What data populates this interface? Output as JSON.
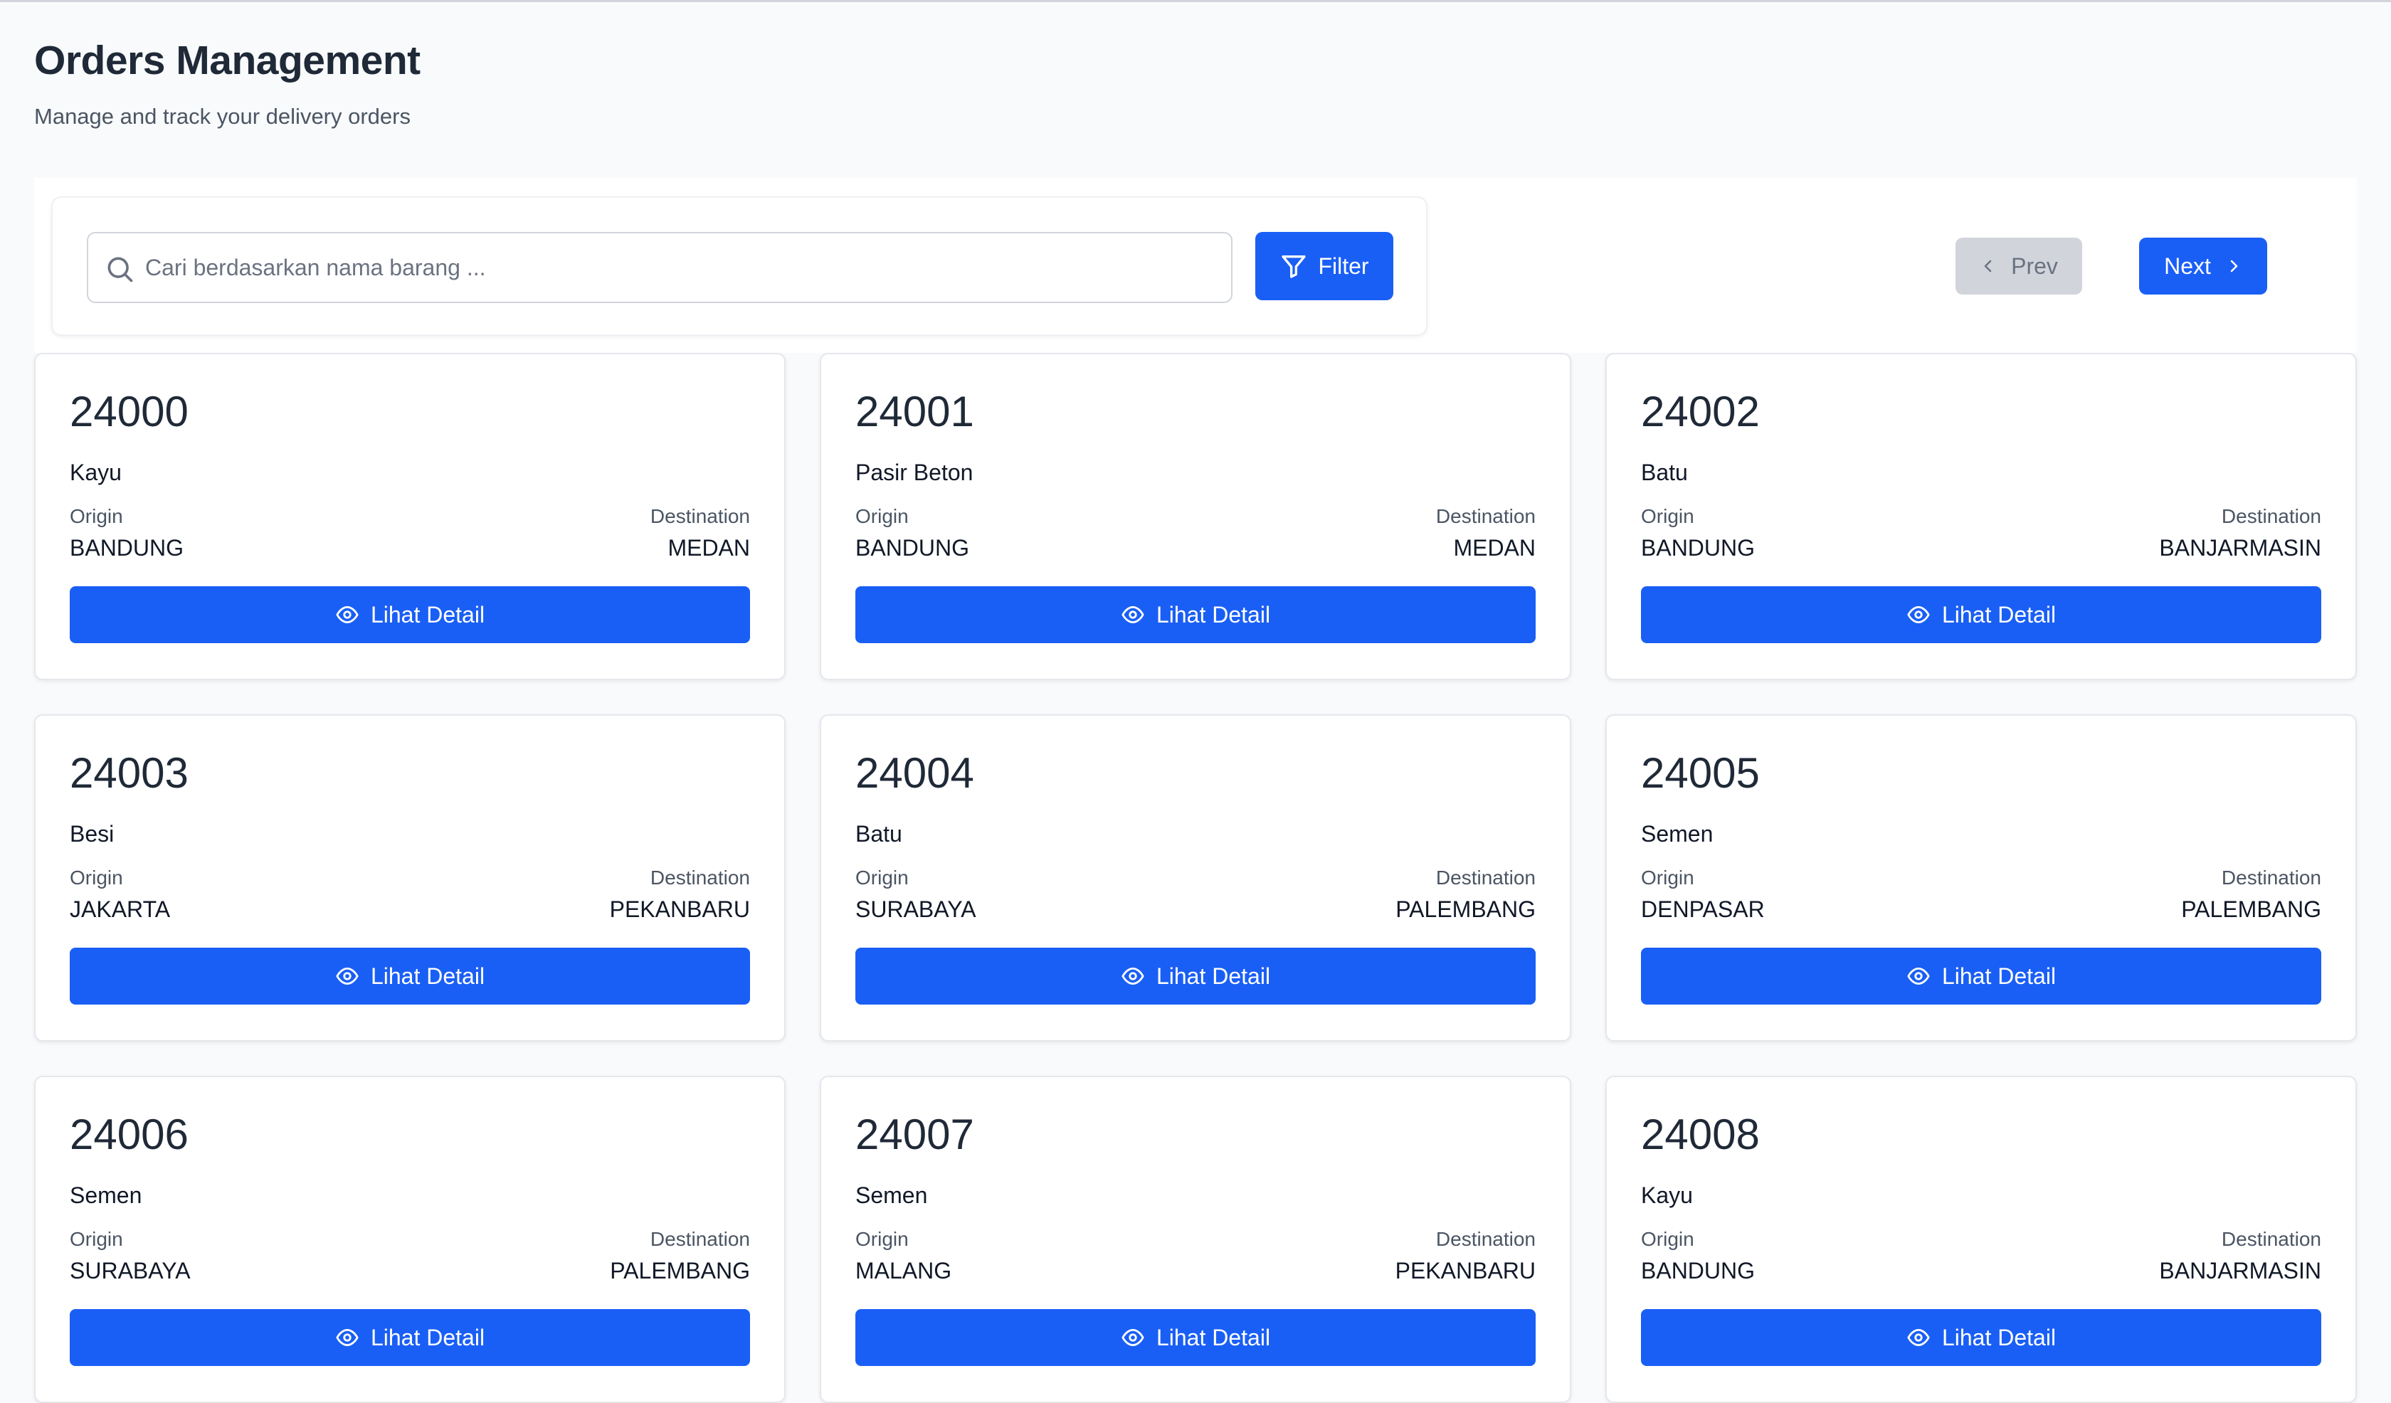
{
  "header": {
    "title": "Orders Management",
    "subtitle": "Manage and track your delivery orders"
  },
  "toolbar": {
    "search_placeholder": "Cari berdasarkan nama barang ...",
    "search_value": "",
    "filter_label": "Filter",
    "prev_label": "Prev",
    "next_label": "Next"
  },
  "card_labels": {
    "origin": "Origin",
    "destination": "Destination",
    "detail_button": "Lihat Detail"
  },
  "orders": [
    {
      "id": "24000",
      "item": "Kayu",
      "origin": "BANDUNG",
      "destination": "MEDAN"
    },
    {
      "id": "24001",
      "item": "Pasir Beton",
      "origin": "BANDUNG",
      "destination": "MEDAN"
    },
    {
      "id": "24002",
      "item": "Batu",
      "origin": "BANDUNG",
      "destination": "BANJARMASIN"
    },
    {
      "id": "24003",
      "item": "Besi",
      "origin": "JAKARTA",
      "destination": "PEKANBARU"
    },
    {
      "id": "24004",
      "item": "Batu",
      "origin": "SURABAYA",
      "destination": "PALEMBANG"
    },
    {
      "id": "24005",
      "item": "Semen",
      "origin": "DENPASAR",
      "destination": "PALEMBANG"
    },
    {
      "id": "24006",
      "item": "Semen",
      "origin": "SURABAYA",
      "destination": "PALEMBANG"
    },
    {
      "id": "24007",
      "item": "Semen",
      "origin": "MALANG",
      "destination": "PEKANBARU"
    },
    {
      "id": "24008",
      "item": "Kayu",
      "origin": "BANDUNG",
      "destination": "BANJARMASIN"
    }
  ],
  "icons": {
    "search": "search-icon",
    "filter": "filter-icon",
    "prev": "chevron-left-icon",
    "next": "chevron-right-icon",
    "detail": "eye-icon"
  },
  "colors": {
    "primary": "#1a5ff5",
    "disabled": "#d1d5db",
    "background": "#f8fafc"
  }
}
